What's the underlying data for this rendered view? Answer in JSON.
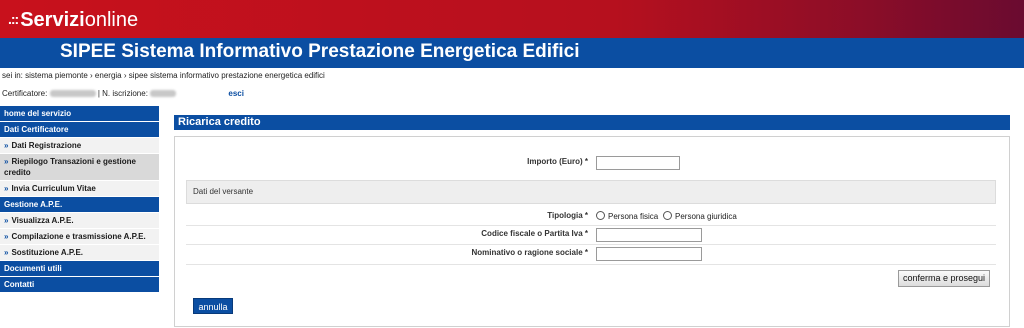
{
  "brand": {
    "dots": ".::",
    "bold": "Servizi",
    "rest": "online"
  },
  "app_title": "SIPEE Sistema Informativo Prestazione Energetica Edifici",
  "breadcrumb": "sei in: sistema piemonte › energia ›  sipee sistema informativo prestazione energetica edifici",
  "cert": {
    "label": "Certificatore:",
    "sep": "| N. iscrizione:",
    "esci": "esci"
  },
  "sidebar": {
    "items": [
      {
        "label": "home del servizio",
        "kind": "header"
      },
      {
        "label": "Dati Certificatore",
        "kind": "header"
      },
      {
        "label": "Dati Registrazione",
        "kind": "sub"
      },
      {
        "label": "Riepilogo Transazioni e gestione credito",
        "kind": "sub",
        "active": true
      },
      {
        "label": "Invia Curriculum Vitae",
        "kind": "sub"
      },
      {
        "label": "Gestione A.P.E.",
        "kind": "header"
      },
      {
        "label": "Visualizza A.P.E.",
        "kind": "sub"
      },
      {
        "label": "Compilazione e trasmissione A.P.E.",
        "kind": "sub"
      },
      {
        "label": "Sostituzione A.P.E.",
        "kind": "sub"
      },
      {
        "label": "Documenti utili",
        "kind": "header"
      },
      {
        "label": "Contatti",
        "kind": "header"
      }
    ]
  },
  "panel": {
    "title": "Ricarica credito"
  },
  "form": {
    "importo_label": "Importo (Euro) *",
    "section_label": "Dati del versante",
    "tipologia_label": "Tipologia *",
    "radio_fisica": "Persona fisica",
    "radio_giuridica": "Persona giuridica",
    "cf_label": "Codice fiscale o Partita Iva *",
    "nominativo_label": "Nominativo o ragione sociale *"
  },
  "buttons": {
    "confirm": "conferma e prosegui",
    "cancel": "annulla"
  },
  "colors": {
    "red": "#c8111c",
    "blue": "#0b4ea2"
  }
}
